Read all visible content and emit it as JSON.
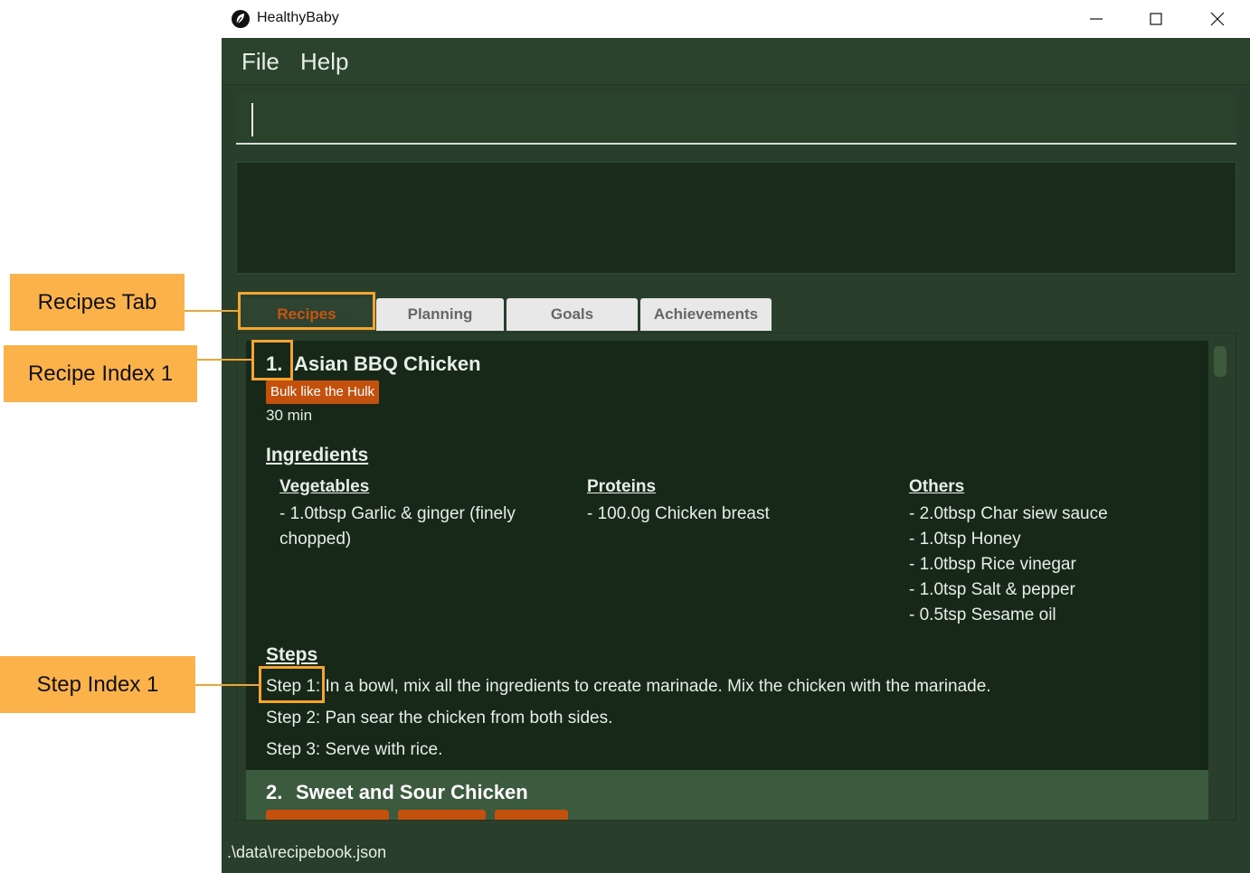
{
  "window": {
    "title": "HealthyBaby",
    "icon": "leaf-icon",
    "controls": [
      "minimize-icon",
      "maximize-icon",
      "close-icon"
    ]
  },
  "menu": {
    "file": "File",
    "help": "Help"
  },
  "command_box": {
    "value": ""
  },
  "result_box": {
    "text": ""
  },
  "tabs": {
    "recipes": "Recipes",
    "planning": "Planning",
    "goals": "Goals",
    "achievements": "Achievements",
    "selected": "Recipes"
  },
  "recipes": [
    {
      "index": "1.",
      "name": "Asian BBQ Chicken",
      "tag": "Bulk like the Hulk",
      "time": "30 min",
      "ingredients_heading": "Ingredients",
      "groups": [
        {
          "title": "Vegetables",
          "items": [
            "- 1.0tbsp Garlic & ginger (finely",
            "chopped)"
          ]
        },
        {
          "title": "Proteins",
          "items": [
            "- 100.0g Chicken breast"
          ]
        },
        {
          "title": "Others",
          "items": [
            "- 2.0tbsp Char siew sauce",
            "- 1.0tsp Honey",
            "- 1.0tbsp Rice vinegar",
            "- 1.0tsp Salt & pepper",
            "- 0.5tsp Sesame oil"
          ]
        }
      ],
      "steps_heading": "Steps",
      "steps": [
        "Step 1: In a bowl, mix all the ingredients to create marinade. Mix the chicken with the marinade.",
        "Step 2: Pan sear the chicken from both sides.",
        "Step 3: Serve with rice."
      ]
    },
    {
      "index": "2.",
      "name": "Sweet and Sour Chicken"
    }
  ],
  "status_bar": {
    "path": ".\\data\\recipebook.json"
  },
  "annotations": {
    "recipes_tab": "Recipes Tab",
    "recipe_index": "Recipe Index 1",
    "step_index": "Step Index 1"
  },
  "colors": {
    "window_bg": "#2a3f2b",
    "card_bg": "#172718",
    "tag": "#c4500e",
    "callout": "#fbb24a",
    "highlight_border": "#f4a531"
  }
}
